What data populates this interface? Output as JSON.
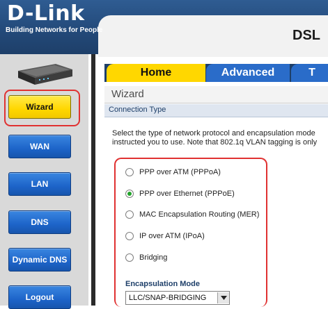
{
  "header": {
    "brand": "D-Link",
    "tagline": "Building Networks for People",
    "model": "DSL"
  },
  "sidebar": {
    "items": [
      {
        "label": "Wizard"
      },
      {
        "label": "WAN"
      },
      {
        "label": "LAN"
      },
      {
        "label": "DNS"
      },
      {
        "label": "Dynamic DNS"
      },
      {
        "label": "Logout"
      }
    ]
  },
  "tabs": [
    {
      "label": "Home"
    },
    {
      "label": "Advanced"
    },
    {
      "label": "T"
    }
  ],
  "main": {
    "title": "Wizard",
    "section": "Connection Type",
    "description_line1": "Select the type of network protocol and encapsulation mode",
    "description_line2": "instructed you to use. Note that 802.1q VLAN tagging is only",
    "options": [
      {
        "label": "PPP over ATM (PPPoA)",
        "selected": false
      },
      {
        "label": "PPP over Ethernet (PPPoE)",
        "selected": true
      },
      {
        "label": "MAC Encapsulation Routing (MER)",
        "selected": false
      },
      {
        "label": "IP over ATM (IPoA)",
        "selected": false
      },
      {
        "label": "Bridging",
        "selected": false
      }
    ],
    "encapsulation_label": "Encapsulation Mode",
    "encapsulation_value": "LLC/SNAP-BRIDGING"
  },
  "colors": {
    "header_blue": "#234a7a",
    "nav_blue": "#1d64c9",
    "active_yellow": "#ffd700",
    "highlight_red": "#e03131",
    "radio_green": "#22a32a"
  }
}
